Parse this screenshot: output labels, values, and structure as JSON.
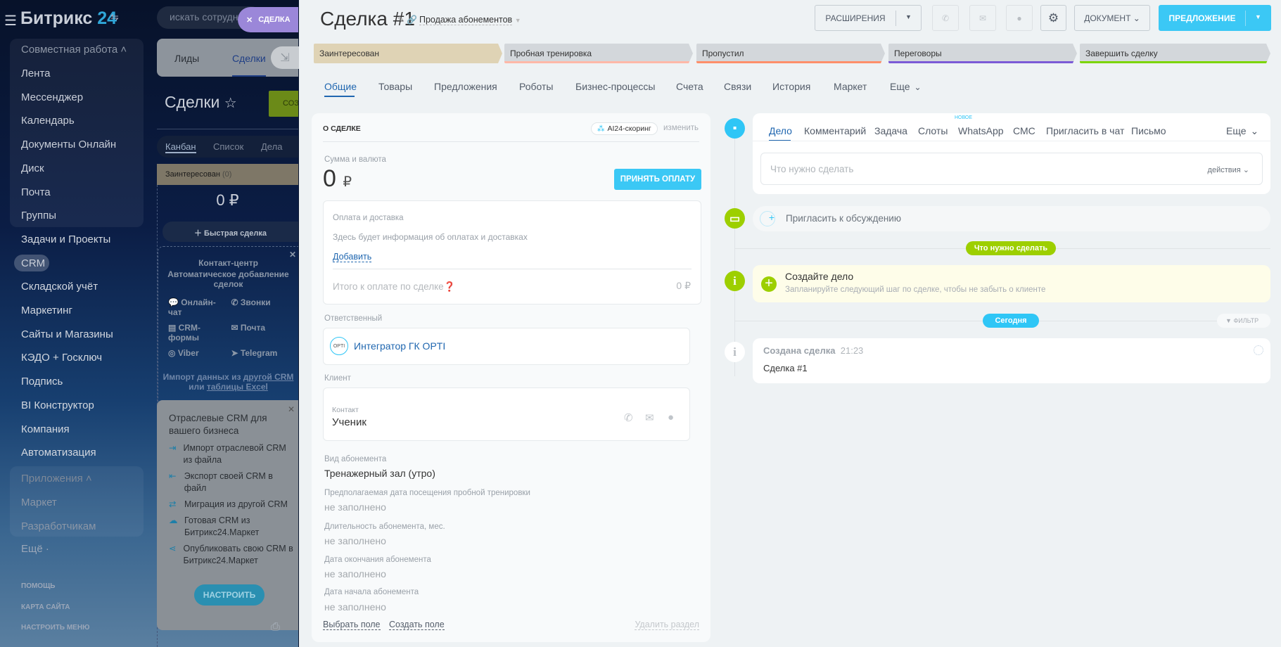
{
  "sidebar": {
    "logo": "Битрикс",
    "logo_num": "24",
    "group1": "Совместная работа",
    "items": [
      "Лента",
      "Мессенджер",
      "Календарь",
      "Документы Онлайн",
      "Диск",
      "Почта",
      "Группы",
      "Задачи и Проекты",
      "CRM",
      "Складской учёт",
      "Маркетинг",
      "Сайты и Магазины",
      "КЭДО + Госключ",
      "Подпись",
      "BI Конструктор",
      "Компания",
      "Автоматизация"
    ],
    "group2": "Приложения",
    "group2_items": [
      "Маркет",
      "Разработчикам"
    ],
    "more": "Ещё",
    "footer": [
      "ПОМОЩЬ",
      "КАРТА САЙТА",
      "НАСТРОИТЬ МЕНЮ"
    ]
  },
  "background": {
    "search_placeholder": "искать сотрудни",
    "close_tab": "СДЕЛКА",
    "tabs": [
      "Лиды",
      "Сделки"
    ],
    "title": "Сделки",
    "create_btn": "СОЗ",
    "views": [
      "Канбан",
      "Список",
      "Дела"
    ],
    "column": {
      "name": "Заинтересован",
      "count": "(0)",
      "sum": "0 ₽",
      "quick": "Быстрая сделка"
    },
    "contact_center": {
      "title": "Контакт-центр",
      "subtitle": "Автоматическое добавление сделок",
      "channels": [
        "Онлайн-чат",
        "Звонки",
        "CRM-формы",
        "Почта",
        "Viber",
        "Telegram"
      ],
      "import1": "Импорт данных из ",
      "import_link1": "другой CRM",
      "import2": "или ",
      "import_link2": "таблицы Excel"
    },
    "industry": {
      "title": "Отраслевые CRM для вашего бизнеса",
      "items": [
        "Импорт отраслевой CRM из файла",
        "Экспорт своей CRM в файл",
        "Миграция из другой CRM",
        "Готовая CRM из Битрикс24.Маркет",
        "Опубликовать свою CRM в Битрикс24.Маркет"
      ],
      "button": "НАСТРОИТЬ"
    }
  },
  "deal": {
    "title": "Сделка #1",
    "pipeline": "Продажа абонементов",
    "toolbar": {
      "extensions": "РАСШИРЕНИЯ",
      "document": "ДОКУМЕНТ",
      "proposal": "ПРЕДЛОЖЕНИЕ"
    },
    "stages": [
      {
        "name": "Заинтересован",
        "color": "#dfd3b5",
        "line": "#dfd3b5"
      },
      {
        "name": "Пробная тренировка",
        "color": "#d3d7db",
        "line": "#ffb8a8"
      },
      {
        "name": "Пропустил",
        "color": "#d3d7db",
        "line": "#ff8f6a"
      },
      {
        "name": "Переговоры",
        "color": "#d3d7db",
        "line": "#7b5bd6"
      },
      {
        "name": "Завершить сделку",
        "color": "#d3d7db",
        "line": "#7bd500"
      }
    ],
    "tabs": [
      "Общие",
      "Товары",
      "Предложения",
      "Роботы",
      "Бизнес-процессы",
      "Счета",
      "Связи",
      "История",
      "Маркет",
      "Еще"
    ],
    "about": {
      "header": "О СДЕЛКЕ",
      "scoring": "AI24-скоринг",
      "change": "изменить",
      "sum_label": "Сумма и валюта",
      "sum": "0",
      "currency": "₽",
      "pay_btn": "ПРИНЯТЬ ОПЛАТУ",
      "payment": {
        "title": "Оплата и доставка",
        "info": "Здесь будет информация об оплатах и доставках",
        "add": "Добавить",
        "total_label": "Итого к оплате по сделке",
        "total": "0 ₽"
      },
      "responsible_label": "Ответственный",
      "responsible": "Интегратор ГК OPTI",
      "client_label": "Клиент",
      "contact_label": "Контакт",
      "contact": "Ученик",
      "fields": [
        {
          "label": "Вид абонемента",
          "value": "Тренажерный зал (утро)"
        },
        {
          "label": "Предполагаемая дата посещения пробной тренировки",
          "value": "не заполнено"
        },
        {
          "label": "Длительность абонемента, мес.",
          "value": "не заполнено"
        },
        {
          "label": "Дата окончания абонемента",
          "value": "не заполнено"
        },
        {
          "label": "Дата начала абонемента",
          "value": "не заполнено"
        }
      ],
      "select_field": "Выбрать поле",
      "create_field": "Создать поле",
      "delete_section": "Удалить раздел"
    },
    "timeline": {
      "tabs": [
        "Дело",
        "Комментарий",
        "Задача",
        "Слоты",
        "WhatsApp",
        "СМС",
        "Пригласить в чат",
        "Письмо"
      ],
      "new_badge": "НОВОЕ",
      "more": "Еще",
      "todo_placeholder": "Что нужно сделать",
      "actions": "действия",
      "invite": "Пригласить к обсуждению",
      "todo_pill": "Что нужно сделать",
      "create_title": "Создайте дело",
      "create_sub": "Запланируйте следующий шаг по сделке, чтобы не забыть о клиенте",
      "today": "Сегодня",
      "filter": "ФИЛЬТР",
      "event_title": "Создана сделка",
      "event_time": "21:23",
      "event_body": "Сделка #1"
    }
  }
}
